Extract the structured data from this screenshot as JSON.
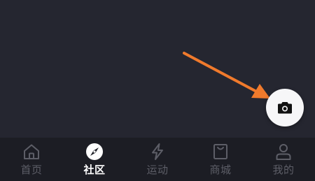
{
  "colors": {
    "background": "#252630",
    "tabbar_background": "#1c1d24",
    "tab_inactive": "#5d5e67",
    "tab_active": "#ffffff",
    "annotation_arrow": "#f07a2c",
    "camera_button": "#f6f6f8"
  },
  "camera_button": {
    "icon": "camera-icon"
  },
  "tabbar": {
    "active_index": 1,
    "items": [
      {
        "label": "首页",
        "icon": "home-icon"
      },
      {
        "label": "社区",
        "icon": "compass-icon"
      },
      {
        "label": "运动",
        "icon": "lightning-icon"
      },
      {
        "label": "商城",
        "icon": "shopping-bag-icon"
      },
      {
        "label": "我的",
        "icon": "person-icon"
      }
    ]
  }
}
